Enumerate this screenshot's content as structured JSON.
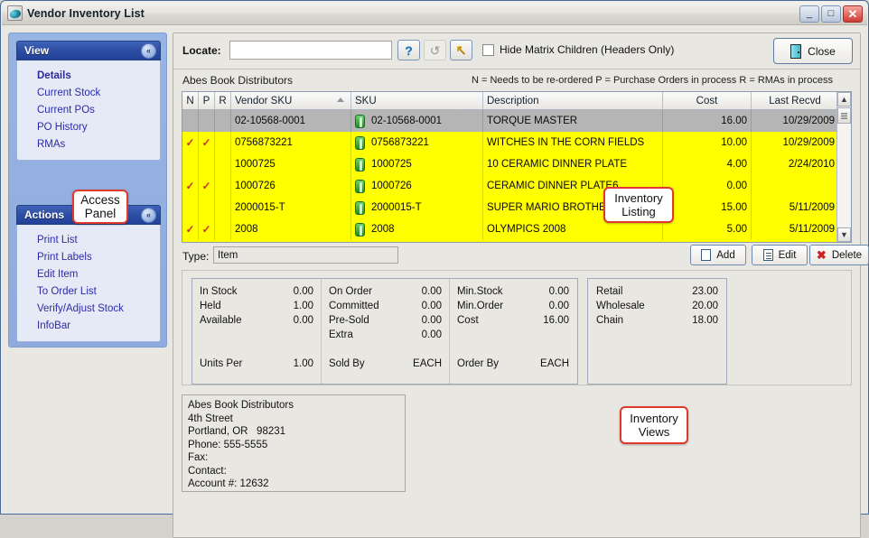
{
  "window": {
    "title": "Vendor Inventory List",
    "icon": "app-icon",
    "controls": {
      "minimize": "_",
      "maximize": "□",
      "close": "✕"
    }
  },
  "access_panel": {
    "groups": [
      {
        "title": "View",
        "collapse_icon": "«",
        "items": [
          {
            "label": "Details",
            "active": true
          },
          {
            "label": "Current Stock",
            "active": false
          },
          {
            "label": "Current POs",
            "active": false
          },
          {
            "label": "PO History",
            "active": false
          },
          {
            "label": "RMAs",
            "active": false
          }
        ]
      },
      {
        "title": "Actions",
        "collapse_icon": "«",
        "items": [
          {
            "label": "Print List",
            "active": false
          },
          {
            "label": "Print Labels",
            "active": false
          },
          {
            "label": "Edit Item",
            "active": false
          },
          {
            "label": "To Order List",
            "active": false
          },
          {
            "label": "Verify/Adjust Stock",
            "active": false
          },
          {
            "label": "InfoBar",
            "active": false
          }
        ]
      }
    ]
  },
  "toolbar": {
    "locate_label": "Locate:",
    "locate_value": "",
    "locate_placeholder": "",
    "help_icon": "?",
    "refresh_icon": "↺",
    "goto_icon": "↖",
    "hide_matrix_label": "Hide Matrix Children (Headers Only)",
    "hide_matrix_checked": false,
    "close_label": "Close",
    "close_icon": "door-icon"
  },
  "grid": {
    "caption": "Abes Book Distributors",
    "legend": "N = Needs to be re-ordered   P = Purchase Orders in process   R = RMAs in process",
    "columns": [
      "N",
      "P",
      "R",
      "Vendor SKU",
      "SKU",
      "Description",
      "Cost",
      "Last Recvd"
    ],
    "sorted_column": "Vendor SKU",
    "sort_direction": "asc",
    "rows": [
      {
        "n": "",
        "p": "",
        "r": "",
        "vendor_sku": "02-10568-0001",
        "sku": "02-10568-0001",
        "description": "TORQUE MASTER",
        "cost": "16.00",
        "last_recvd": "10/29/2009",
        "selected": true
      },
      {
        "n": "✓",
        "p": "✓",
        "r": "",
        "vendor_sku": "0756873221",
        "sku": "0756873221",
        "description": "WITCHES IN THE CORN FIELDS",
        "cost": "10.00",
        "last_recvd": "10/29/2009",
        "selected": false
      },
      {
        "n": "",
        "p": "",
        "r": "",
        "vendor_sku": "1000725",
        "sku": "1000725",
        "description": "10 CERAMIC DINNER PLATE",
        "cost": "4.00",
        "last_recvd": "2/24/2010",
        "selected": false
      },
      {
        "n": "✓",
        "p": "✓",
        "r": "",
        "vendor_sku": "1000726",
        "sku": "1000726",
        "description": "CERAMIC DINNER PLATE6",
        "cost": "0.00",
        "last_recvd": "",
        "selected": false
      },
      {
        "n": "",
        "p": "",
        "r": "",
        "vendor_sku": "2000015-T",
        "sku": "2000015-T",
        "description": "SUPER MARIO BROTHERS",
        "cost": "15.00",
        "last_recvd": "5/11/2009",
        "selected": false
      },
      {
        "n": "✓",
        "p": "✓",
        "r": "",
        "vendor_sku": "2008",
        "sku": "2008",
        "description": "OLYMPICS 2008",
        "cost": "5.00",
        "last_recvd": "5/11/2009",
        "selected": false
      }
    ],
    "scrollbar": {
      "up_icon": "▲",
      "down_icon": "▼"
    }
  },
  "type_row": {
    "label": "Type:",
    "value": "Item",
    "add_label": "Add",
    "edit_label": "Edit",
    "delete_label": "Delete"
  },
  "details": {
    "col1": [
      {
        "k": "In Stock",
        "v": "0.00"
      },
      {
        "k": "Held",
        "v": "1.00"
      },
      {
        "k": "Available",
        "v": "0.00"
      },
      {
        "k": "Units Per",
        "v": "1.00"
      }
    ],
    "col2": [
      {
        "k": "On Order",
        "v": "0.00"
      },
      {
        "k": "Committed",
        "v": "0.00"
      },
      {
        "k": "Pre-Sold",
        "v": "0.00"
      },
      {
        "k": "Extra",
        "v": "0.00"
      },
      {
        "k": "Sold By",
        "v": "EACH"
      }
    ],
    "col3": [
      {
        "k": "Min.Stock",
        "v": "0.00"
      },
      {
        "k": "Min.Order",
        "v": "0.00"
      },
      {
        "k": "Cost",
        "v": "16.00"
      },
      {
        "k": "Order By",
        "v": "EACH"
      }
    ],
    "prices": [
      {
        "k": "Retail",
        "v": "23.00"
      },
      {
        "k": "Wholesale",
        "v": "20.00"
      },
      {
        "k": "Chain",
        "v": "18.00"
      }
    ]
  },
  "address": {
    "lines": [
      "Abes Book Distributors",
      "4th Street",
      "Portland, OR   98231",
      "Phone: 555-5555",
      "Fax:",
      "Contact:",
      "Account #: 12632"
    ]
  },
  "callouts": {
    "access_panel": "Access Panel",
    "inventory_listing": "Inventory Listing",
    "inventory_views": "Inventory Views"
  },
  "colors": {
    "highlight_row": "#ffff00",
    "selected_row": "#b5b5b5",
    "callout_border": "#e03a2f",
    "panel_header": "#2e4ea3",
    "link_text": "#2b2ba8"
  }
}
